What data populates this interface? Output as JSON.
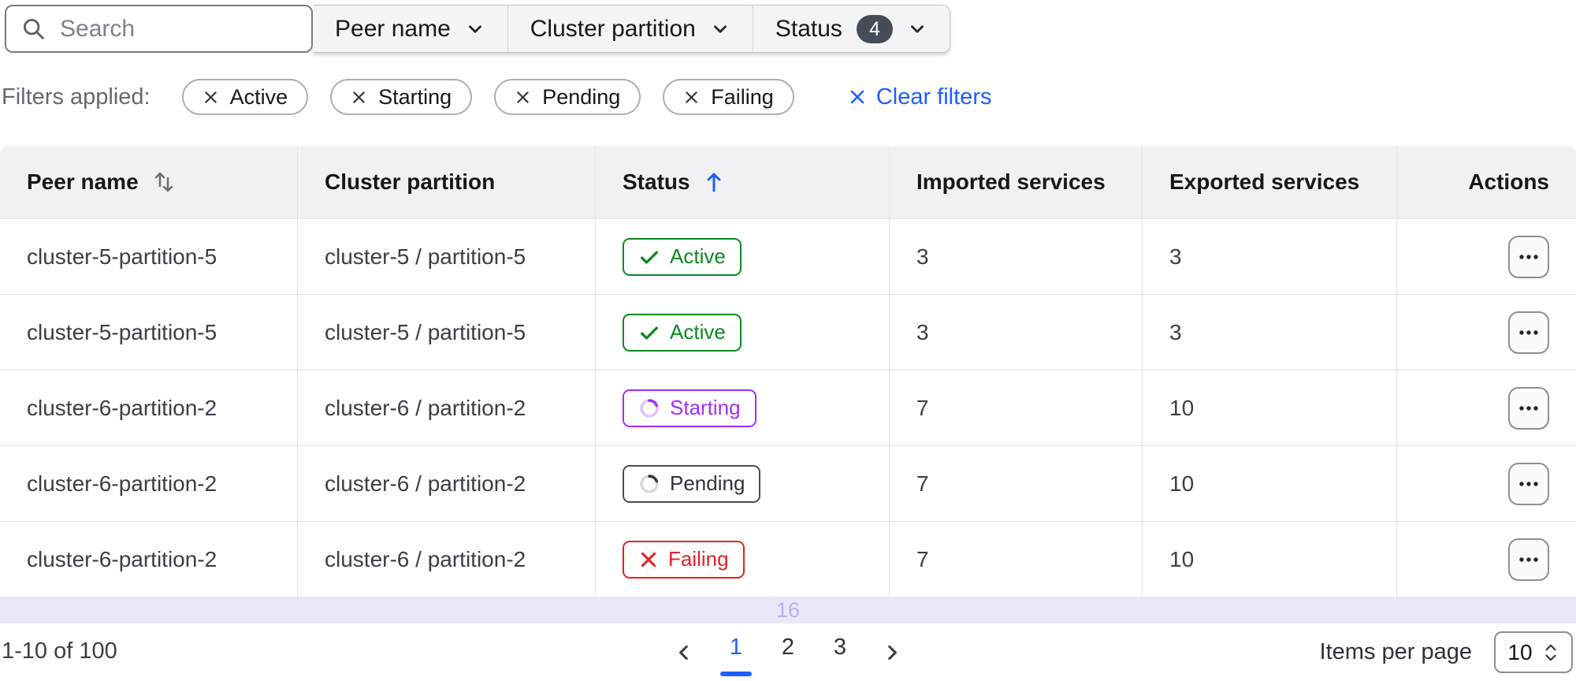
{
  "toolbar": {
    "search": {
      "placeholder": "Search"
    },
    "filters": [
      {
        "label": "Peer name"
      },
      {
        "label": "Cluster partition"
      },
      {
        "label": "Status",
        "badge": "4"
      }
    ]
  },
  "applied_filters": {
    "label": "Filters applied:",
    "chips": [
      "Active",
      "Starting",
      "Pending",
      "Failing"
    ],
    "clear_label": "Clear filters"
  },
  "table": {
    "columns": [
      {
        "label": "Peer name",
        "sort": "sortable"
      },
      {
        "label": "Cluster partition",
        "sort": "none"
      },
      {
        "label": "Status",
        "sort": "asc"
      },
      {
        "label": "Imported services",
        "sort": "none"
      },
      {
        "label": "Exported services",
        "sort": "none"
      },
      {
        "label": "Actions",
        "sort": "none"
      }
    ],
    "rows": [
      {
        "peer_name": "cluster-5-partition-5",
        "cluster_partition": "cluster-5 / partition-5",
        "status": "Active",
        "status_kind": "active",
        "imported": "3",
        "exported": "3"
      },
      {
        "peer_name": "cluster-5-partition-5",
        "cluster_partition": "cluster-5 / partition-5",
        "status": "Active",
        "status_kind": "active",
        "imported": "3",
        "exported": "3"
      },
      {
        "peer_name": "cluster-6-partition-2",
        "cluster_partition": "cluster-6 / partition-2",
        "status": "Starting",
        "status_kind": "starting",
        "imported": "7",
        "exported": "10"
      },
      {
        "peer_name": "cluster-6-partition-2",
        "cluster_partition": "cluster-6 / partition-2",
        "status": "Pending",
        "status_kind": "pending",
        "imported": "7",
        "exported": "10"
      },
      {
        "peer_name": "cluster-6-partition-2",
        "cluster_partition": "cluster-6 / partition-2",
        "status": "Failing",
        "status_kind": "failing",
        "imported": "7",
        "exported": "10"
      }
    ],
    "partial_row_text": "16"
  },
  "pagination": {
    "range_label": "1-10 of 100",
    "pages": [
      "1",
      "2",
      "3"
    ],
    "active_page": "1",
    "items_per_page_label": "Items per page",
    "items_per_page_value": "10"
  },
  "colors": {
    "accent_blue": "#1f5eff",
    "status_active_green": "#0b8a1e",
    "status_starting_purple": "#a22ff9",
    "status_pending_gray": "#2f343c",
    "status_failing_red": "#e02226",
    "count_badge_bg": "#454b57",
    "header_bg": "#f1f1f4",
    "row_border": "#e2e3e8",
    "partial_row_bg": "#e8e8f8"
  }
}
